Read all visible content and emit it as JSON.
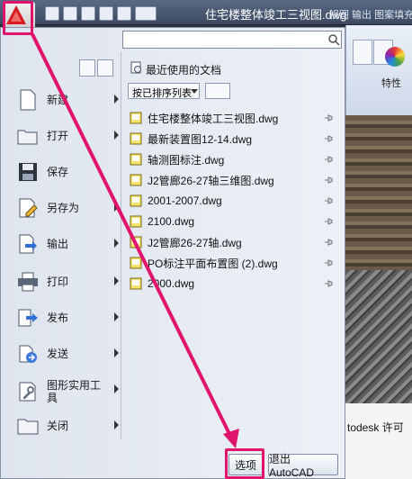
{
  "window": {
    "title": "住宅楼整体竣工三视图.dwg"
  },
  "ribbon": {
    "tabs_text": "视图  输出  图案填充",
    "properties_label": "特性"
  },
  "status": {
    "text": "todesk 许可"
  },
  "search": {
    "value": ""
  },
  "menu_items": [
    {
      "label": "新建",
      "has_submenu": true,
      "icon": "new-doc-icon"
    },
    {
      "label": "打开",
      "has_submenu": true,
      "icon": "open-folder-icon"
    },
    {
      "label": "保存",
      "has_submenu": false,
      "icon": "save-disk-icon"
    },
    {
      "label": "另存为",
      "has_submenu": true,
      "icon": "save-as-icon"
    },
    {
      "label": "输出",
      "has_submenu": true,
      "icon": "export-icon"
    },
    {
      "label": "打印",
      "has_submenu": true,
      "icon": "printer-icon"
    },
    {
      "label": "发布",
      "has_submenu": true,
      "icon": "publish-icon"
    },
    {
      "label": "发送",
      "has_submenu": true,
      "icon": "send-icon"
    },
    {
      "label": "图形实用工具",
      "has_submenu": true,
      "icon": "drawing-utilities-icon"
    },
    {
      "label": "关闭",
      "has_submenu": true,
      "icon": "close-folder-icon"
    }
  ],
  "recent": {
    "title": "最近使用的文档",
    "sort_label": "按已排序列表",
    "files": [
      "住宅楼整体竣工三视图.dwg",
      "最新装置图12-14.dwg",
      "轴测图标注.dwg",
      "J2管廊26-27轴三维图.dwg",
      "2001-2007.dwg",
      "2100.dwg",
      "J2管廊26-27轴.dwg",
      "PO标注平面布置图 (2).dwg",
      "2000.dwg"
    ]
  },
  "buttons": {
    "options": "选项",
    "exit": "退出 AutoCAD"
  },
  "colors": {
    "highlight": "#e0146c",
    "menu_bg": "#dfe5ee",
    "title_bar": "#3b4860"
  }
}
